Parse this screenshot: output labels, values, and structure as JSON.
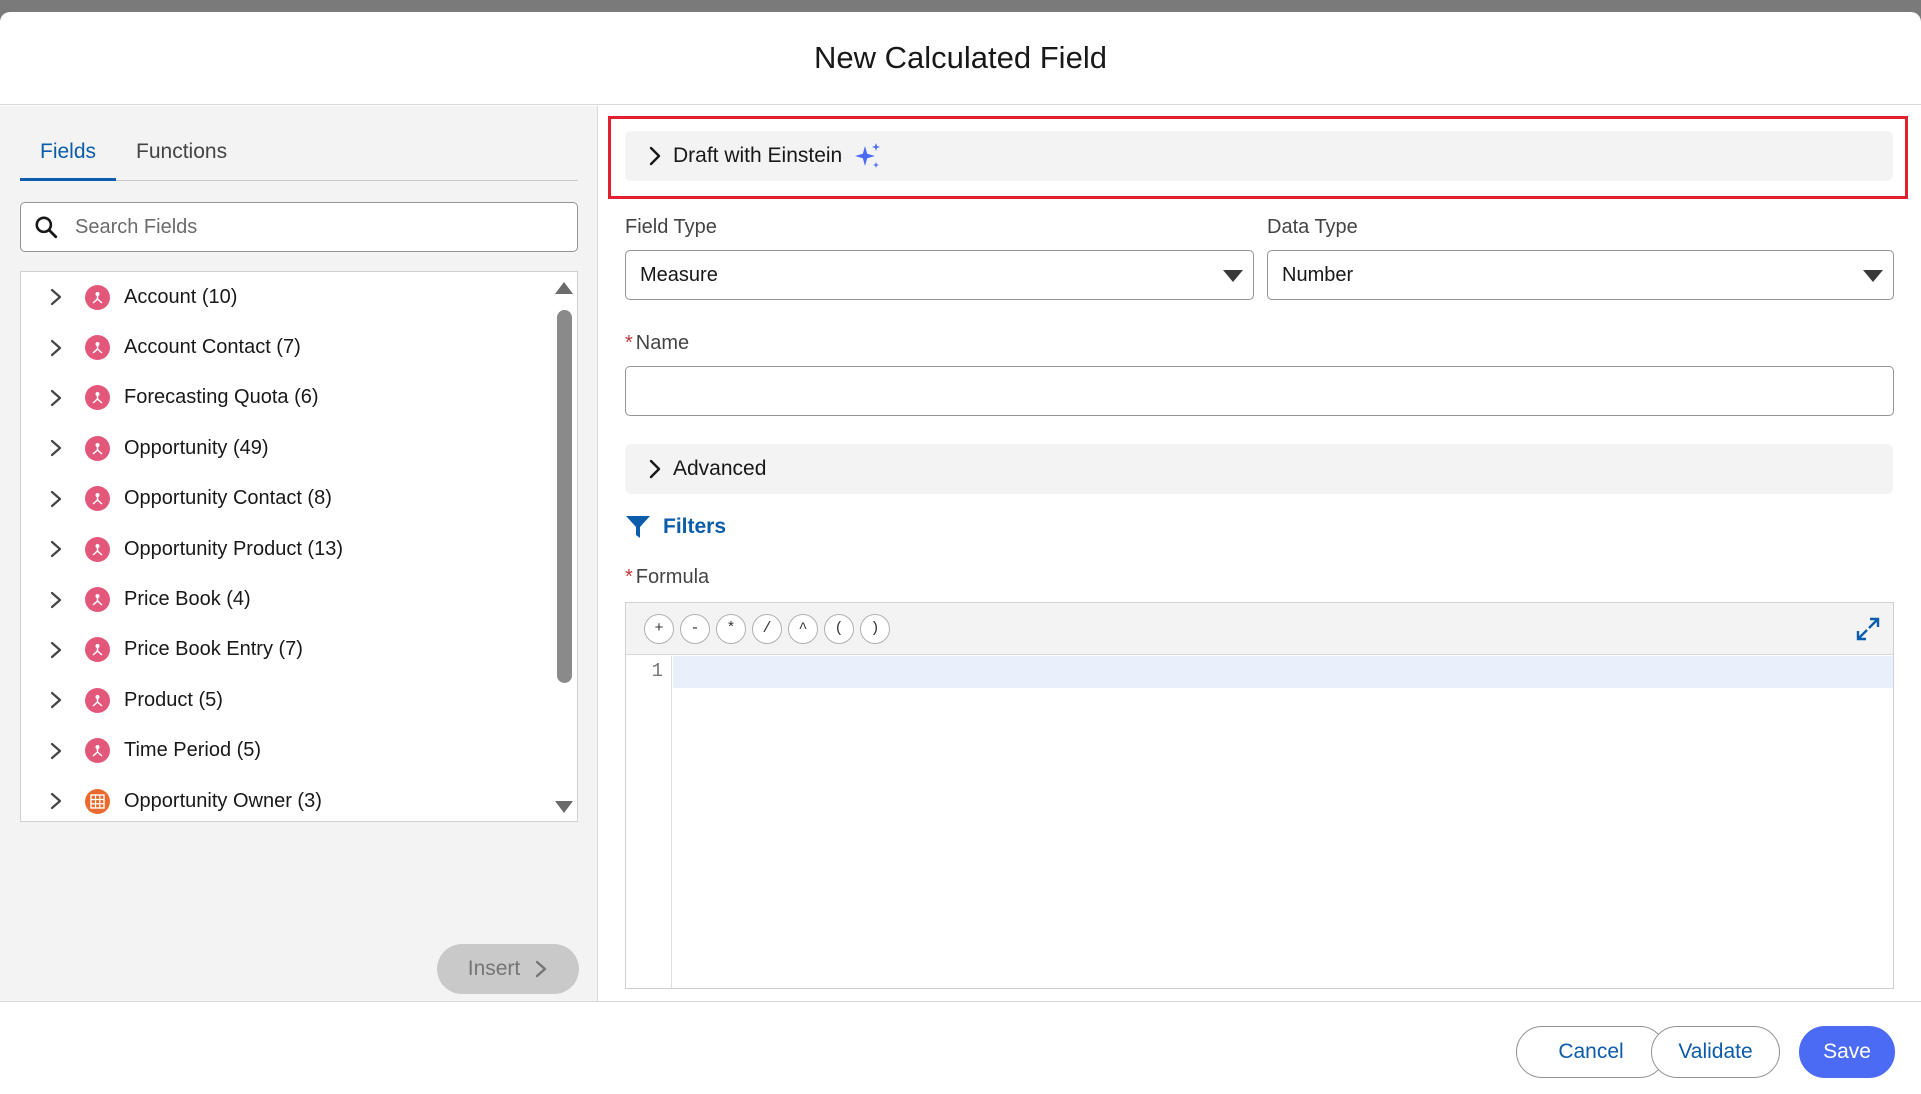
{
  "modal": {
    "title": "New Calculated Field"
  },
  "tabs": [
    {
      "label": "Fields",
      "active": true
    },
    {
      "label": "Functions",
      "active": false
    }
  ],
  "search": {
    "placeholder": "Search Fields",
    "value": ""
  },
  "tree": {
    "items": [
      {
        "label": "Account (10)",
        "icon": "object-icon",
        "color": "#e3577b"
      },
      {
        "label": "Account Contact (7)",
        "icon": "object-icon",
        "color": "#e3577b"
      },
      {
        "label": "Forecasting Quota (6)",
        "icon": "object-icon",
        "color": "#e3577b"
      },
      {
        "label": "Opportunity (49)",
        "icon": "object-icon",
        "color": "#e3577b"
      },
      {
        "label": "Opportunity Contact (8)",
        "icon": "object-icon",
        "color": "#e3577b"
      },
      {
        "label": "Opportunity Product (13)",
        "icon": "object-icon",
        "color": "#e3577b"
      },
      {
        "label": "Price Book (4)",
        "icon": "object-icon",
        "color": "#e3577b"
      },
      {
        "label": "Price Book Entry (7)",
        "icon": "object-icon",
        "color": "#e3577b"
      },
      {
        "label": "Product (5)",
        "icon": "object-icon",
        "color": "#e3577b"
      },
      {
        "label": "Time Period (5)",
        "icon": "object-icon",
        "color": "#e3577b"
      },
      {
        "label": "Opportunity Owner (3)",
        "icon": "table-icon",
        "color": "#e96a2c"
      }
    ]
  },
  "insert": {
    "label": "Insert"
  },
  "einstein": {
    "label": "Draft with Einstein"
  },
  "field_type": {
    "label": "Field Type",
    "value": "Measure"
  },
  "data_type": {
    "label": "Data Type",
    "value": "Number"
  },
  "name": {
    "label": "Name",
    "required_marker": "*",
    "value": ""
  },
  "advanced": {
    "label": "Advanced"
  },
  "filters": {
    "label": "Filters"
  },
  "formula": {
    "label": "Formula",
    "required_marker": "*",
    "operators": [
      "+",
      "-",
      "*",
      "/",
      "^",
      "(",
      ")"
    ],
    "line_number": "1",
    "value": ""
  },
  "footer": {
    "cancel": "Cancel",
    "validate": "Validate",
    "save": "Save"
  },
  "colors": {
    "accent": "#0b5cab",
    "brand_button": "#4b6bf5",
    "highlight_outline": "#e0202f"
  }
}
